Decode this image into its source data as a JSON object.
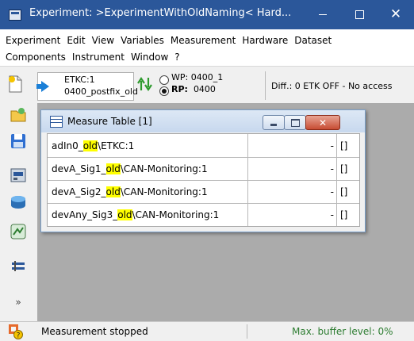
{
  "window": {
    "title": "Experiment: >ExperimentWithOldNaming< Hard...",
    "minimize_glyph": "—",
    "maximize_glyph": "☐",
    "close_glyph": "✕"
  },
  "menu": {
    "row1": [
      "Experiment",
      "Edit",
      "View",
      "Variables",
      "Measurement",
      "Hardware",
      "Dataset"
    ],
    "row2": [
      "Components",
      "Instrument",
      "Window",
      "?"
    ]
  },
  "toolbar": {
    "device_name": "ETKC:1",
    "dataset_name": "0400_postfix_old",
    "wp_label": "WP:",
    "wp_value": "0400_1",
    "rp_label": "RP:",
    "rp_value": "0400",
    "selected_page": "RP",
    "status": "Diff.: 0  ETK OFF - No access"
  },
  "measure_window": {
    "title": "Measure Table [1]",
    "close_glyph": "✕",
    "rows": [
      {
        "prefix": "adIn0_",
        "highlight": "old",
        "suffix": "\\ETKC:1",
        "value": "-",
        "unit": "[]"
      },
      {
        "prefix": "devA_Sig1_",
        "highlight": "old",
        "suffix": "\\CAN-Monitoring:1",
        "value": "-",
        "unit": "[]"
      },
      {
        "prefix": "devA_Sig2_",
        "highlight": "old",
        "suffix": "\\CAN-Monitoring:1",
        "value": "-",
        "unit": "[]"
      },
      {
        "prefix": "devAny_Sig3_",
        "highlight": "old",
        "suffix": "\\CAN-Monitoring:1",
        "value": "-",
        "unit": "[]"
      }
    ]
  },
  "sidebar": {
    "icons": [
      "new-icon",
      "open-folder-icon",
      "save-icon",
      "hardware-config-icon",
      "database-icon",
      "network-icon",
      "layout-icon",
      "more-icon"
    ],
    "more_glyph": "»"
  },
  "statusbar": {
    "status_text": "Measurement stopped",
    "buffer_text": "Max. buffer level: 0%"
  },
  "colors": {
    "titlebar": "#2b579a",
    "highlight": "#ffff00",
    "workspace": "#ababab",
    "buffer_text": "#2e7d32"
  }
}
